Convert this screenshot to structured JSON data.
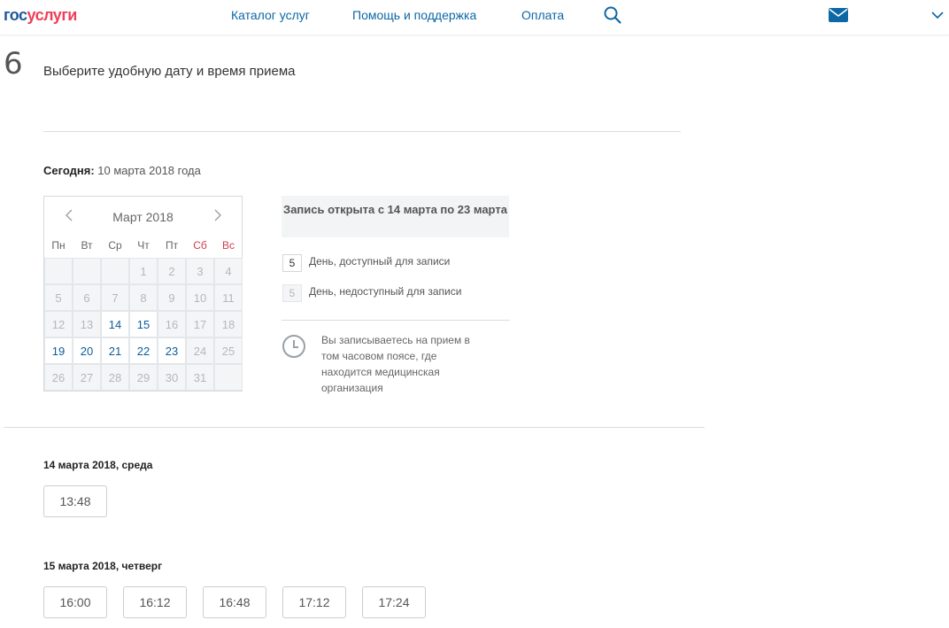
{
  "header": {
    "logo_part1": "гос",
    "logo_part2": "услуги",
    "nav": [
      {
        "label": "Каталог услуг"
      },
      {
        "label": "Помощь и поддержка"
      },
      {
        "label": "Оплата"
      }
    ],
    "icons": [
      "search-icon",
      "mail-icon",
      "chevron-down-icon"
    ],
    "accent_color": "#0d67a5",
    "brand_red": "#ee3f58"
  },
  "step": {
    "number": "6",
    "title": "Выберите удобную дату и время приема"
  },
  "today": {
    "label": "Сегодня:",
    "value": "10 марта 2018 года"
  },
  "calendar": {
    "month": "Март 2018",
    "weekdays": [
      "Пн",
      "Вт",
      "Ср",
      "Чт",
      "Пт",
      "Сб",
      "Вс"
    ],
    "weeks": [
      [
        {
          "d": "",
          "s": "empty"
        },
        {
          "d": "",
          "s": "empty"
        },
        {
          "d": "",
          "s": "empty"
        },
        {
          "d": "1",
          "s": "disabled"
        },
        {
          "d": "2",
          "s": "disabled"
        },
        {
          "d": "3",
          "s": "disabled"
        },
        {
          "d": "4",
          "s": "disabled"
        }
      ],
      [
        {
          "d": "5",
          "s": "disabled"
        },
        {
          "d": "6",
          "s": "disabled"
        },
        {
          "d": "7",
          "s": "disabled"
        },
        {
          "d": "8",
          "s": "disabled"
        },
        {
          "d": "9",
          "s": "disabled"
        },
        {
          "d": "10",
          "s": "disabled"
        },
        {
          "d": "11",
          "s": "disabled"
        }
      ],
      [
        {
          "d": "12",
          "s": "disabled"
        },
        {
          "d": "13",
          "s": "disabled"
        },
        {
          "d": "14",
          "s": "available"
        },
        {
          "d": "15",
          "s": "available"
        },
        {
          "d": "16",
          "s": "disabled"
        },
        {
          "d": "17",
          "s": "disabled"
        },
        {
          "d": "18",
          "s": "disabled"
        }
      ],
      [
        {
          "d": "19",
          "s": "available"
        },
        {
          "d": "20",
          "s": "available"
        },
        {
          "d": "21",
          "s": "available"
        },
        {
          "d": "22",
          "s": "available"
        },
        {
          "d": "23",
          "s": "available"
        },
        {
          "d": "24",
          "s": "disabled"
        },
        {
          "d": "25",
          "s": "disabled"
        }
      ],
      [
        {
          "d": "26",
          "s": "disabled"
        },
        {
          "d": "27",
          "s": "disabled"
        },
        {
          "d": "28",
          "s": "disabled"
        },
        {
          "d": "29",
          "s": "disabled"
        },
        {
          "d": "30",
          "s": "disabled"
        },
        {
          "d": "31",
          "s": "disabled"
        },
        {
          "d": "",
          "s": "empty"
        }
      ]
    ]
  },
  "info": {
    "notice": "Запись открыта с 14 марта по 23 марта",
    "legend_available_sample": "5",
    "legend_available": "День, доступный для записи",
    "legend_unavailable_sample": "5",
    "legend_unavailable": "День, недоступный для записи",
    "timezone_note": "Вы записываетесь на прием в том часовом поясе, где находится медицинская организация"
  },
  "slots": [
    {
      "heading": "14 марта 2018, среда",
      "times": [
        "13:48"
      ]
    },
    {
      "heading": "15 марта 2018, четверг",
      "times": [
        "16:00",
        "16:12",
        "16:48",
        "17:12",
        "17:24"
      ]
    }
  ]
}
